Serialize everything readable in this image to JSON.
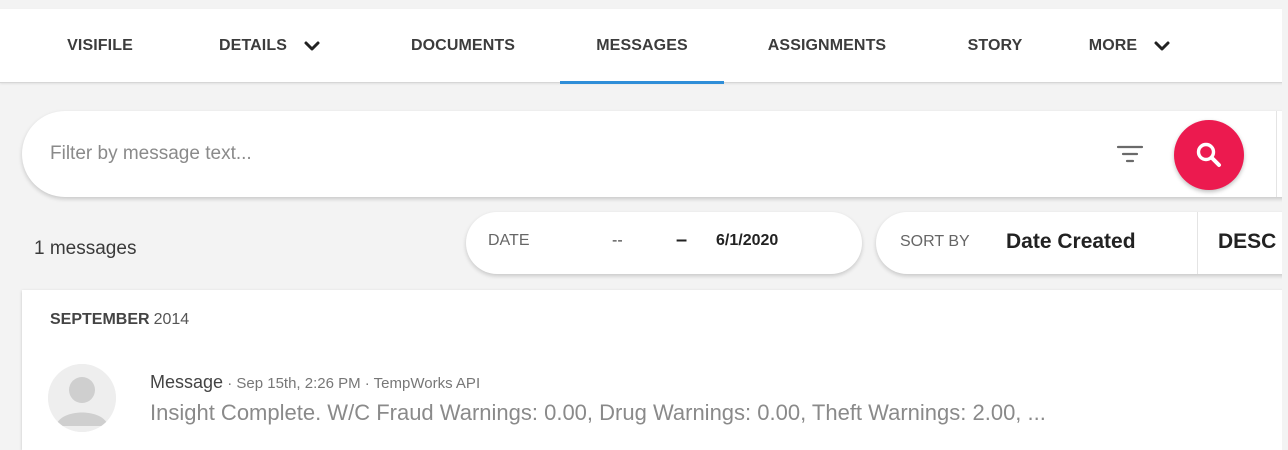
{
  "tabs": [
    {
      "label": "VISIFILE",
      "dropdown": false,
      "active": false
    },
    {
      "label": "DETAILS",
      "dropdown": true,
      "active": false
    },
    {
      "label": "DOCUMENTS",
      "dropdown": false,
      "active": false
    },
    {
      "label": "MESSAGES",
      "dropdown": false,
      "active": true
    },
    {
      "label": "ASSIGNMENTS",
      "dropdown": false,
      "active": false
    },
    {
      "label": "STORY",
      "dropdown": false,
      "active": false
    },
    {
      "label": "MORE",
      "dropdown": true,
      "active": false
    }
  ],
  "filter": {
    "placeholder": "Filter by message text...",
    "value": ""
  },
  "summary": {
    "count_text": "1 messages"
  },
  "date_range": {
    "label": "DATE",
    "from": "--",
    "separator": "–",
    "to": "6/1/2020"
  },
  "sort": {
    "label": "SORT BY",
    "field": "Date Created",
    "direction": "DESC"
  },
  "messages": {
    "group": {
      "month": "SEPTEMBER",
      "year": "2014"
    },
    "items": [
      {
        "type": "Message",
        "meta": " · Sep 15th, 2:26 PM · TempWorks API",
        "body": "Insight Complete. W/C Fraud Warnings: 0.00, Drug Warnings: 0.00, Theft Warnings: 2.00, ..."
      }
    ]
  },
  "colors": {
    "accent": "#2f8ed8",
    "search_button": "#ec1a4f",
    "background": "#f3f3f3"
  },
  "icons": {
    "filter": "filter-lines-icon",
    "search": "search-icon",
    "dropdown": "chevron-down-icon",
    "avatar": "user-avatar-icon"
  }
}
